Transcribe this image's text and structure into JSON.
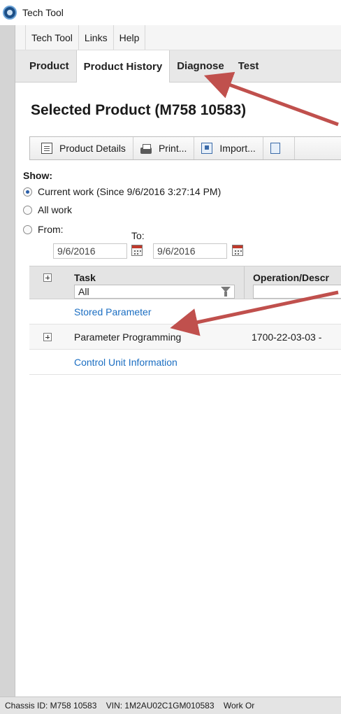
{
  "window": {
    "title": "Tech Tool"
  },
  "menu": {
    "items": [
      "Tech Tool",
      "Links",
      "Help"
    ]
  },
  "tabs": [
    "Product",
    "Product History",
    "Diagnose",
    "Test"
  ],
  "heading": "Selected Product (M758 10583)",
  "toolbar": {
    "product_details": "Product Details",
    "print": "Print...",
    "import": "Import..."
  },
  "filter": {
    "show_label": "Show:",
    "current_work": "Current work (Since 9/6/2016 3:27:14 PM)",
    "all_work": "All work",
    "from_label": "From:",
    "to_label": "To:",
    "from_date": "9/6/2016",
    "to_date": "9/6/2016",
    "selected": "current_work"
  },
  "grid": {
    "columns": {
      "task": "Task",
      "operation": "Operation/Descr"
    },
    "task_filter": "All",
    "rows": [
      {
        "task": "Stored Parameter",
        "operation": "",
        "link": true,
        "expandable": false
      },
      {
        "task": "Parameter Programming",
        "operation": "1700-22-03-03 -",
        "link": false,
        "expandable": true
      },
      {
        "task": "Control Unit Information",
        "operation": "",
        "link": true,
        "expandable": false
      }
    ]
  },
  "status": {
    "chassis": "Chassis ID: M758 10583",
    "vin": "VIN: 1M2AU02C1GM010583",
    "work": "Work Or"
  },
  "colors": {
    "link": "#1b6ec2",
    "annotation_arrow": "#c0504d",
    "app_icon": "#1d4f86"
  }
}
